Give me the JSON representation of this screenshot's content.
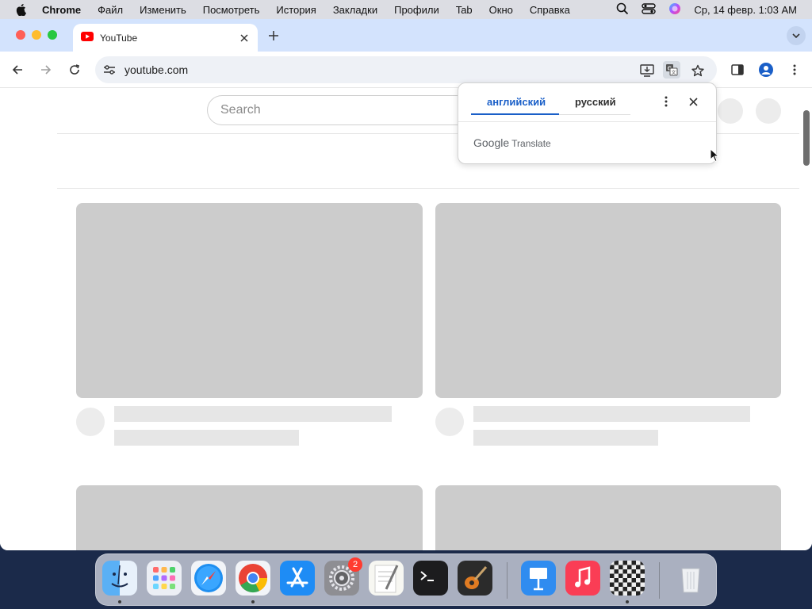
{
  "menubar": {
    "app_name": "Chrome",
    "items": [
      "Файл",
      "Изменить",
      "Посмотреть",
      "История",
      "Закладки",
      "Профили",
      "Tab",
      "Окно",
      "Справка"
    ],
    "clock": "Ср, 14 февр. 1:03 AM"
  },
  "browser": {
    "tab": {
      "title": "YouTube"
    },
    "omnibox": {
      "url": "youtube.com"
    }
  },
  "page": {
    "search_placeholder": "Search"
  },
  "translate_popup": {
    "source_language": "английский",
    "target_language": "русский",
    "brand_google": "Google",
    "brand_translate": "Translate"
  },
  "dock": {
    "apps": [
      "Finder",
      "Launchpad",
      "Safari",
      "Chrome",
      "App Store",
      "System Settings",
      "TextEdit",
      "Terminal",
      "GarageBand",
      "Keynote",
      "Music",
      "Chess",
      "Trash"
    ],
    "settings_badge": "2"
  },
  "colors": {
    "tabstrip": "#d3e3fd",
    "accent": "#1a5fc8",
    "placeholder": "#cccccc"
  }
}
